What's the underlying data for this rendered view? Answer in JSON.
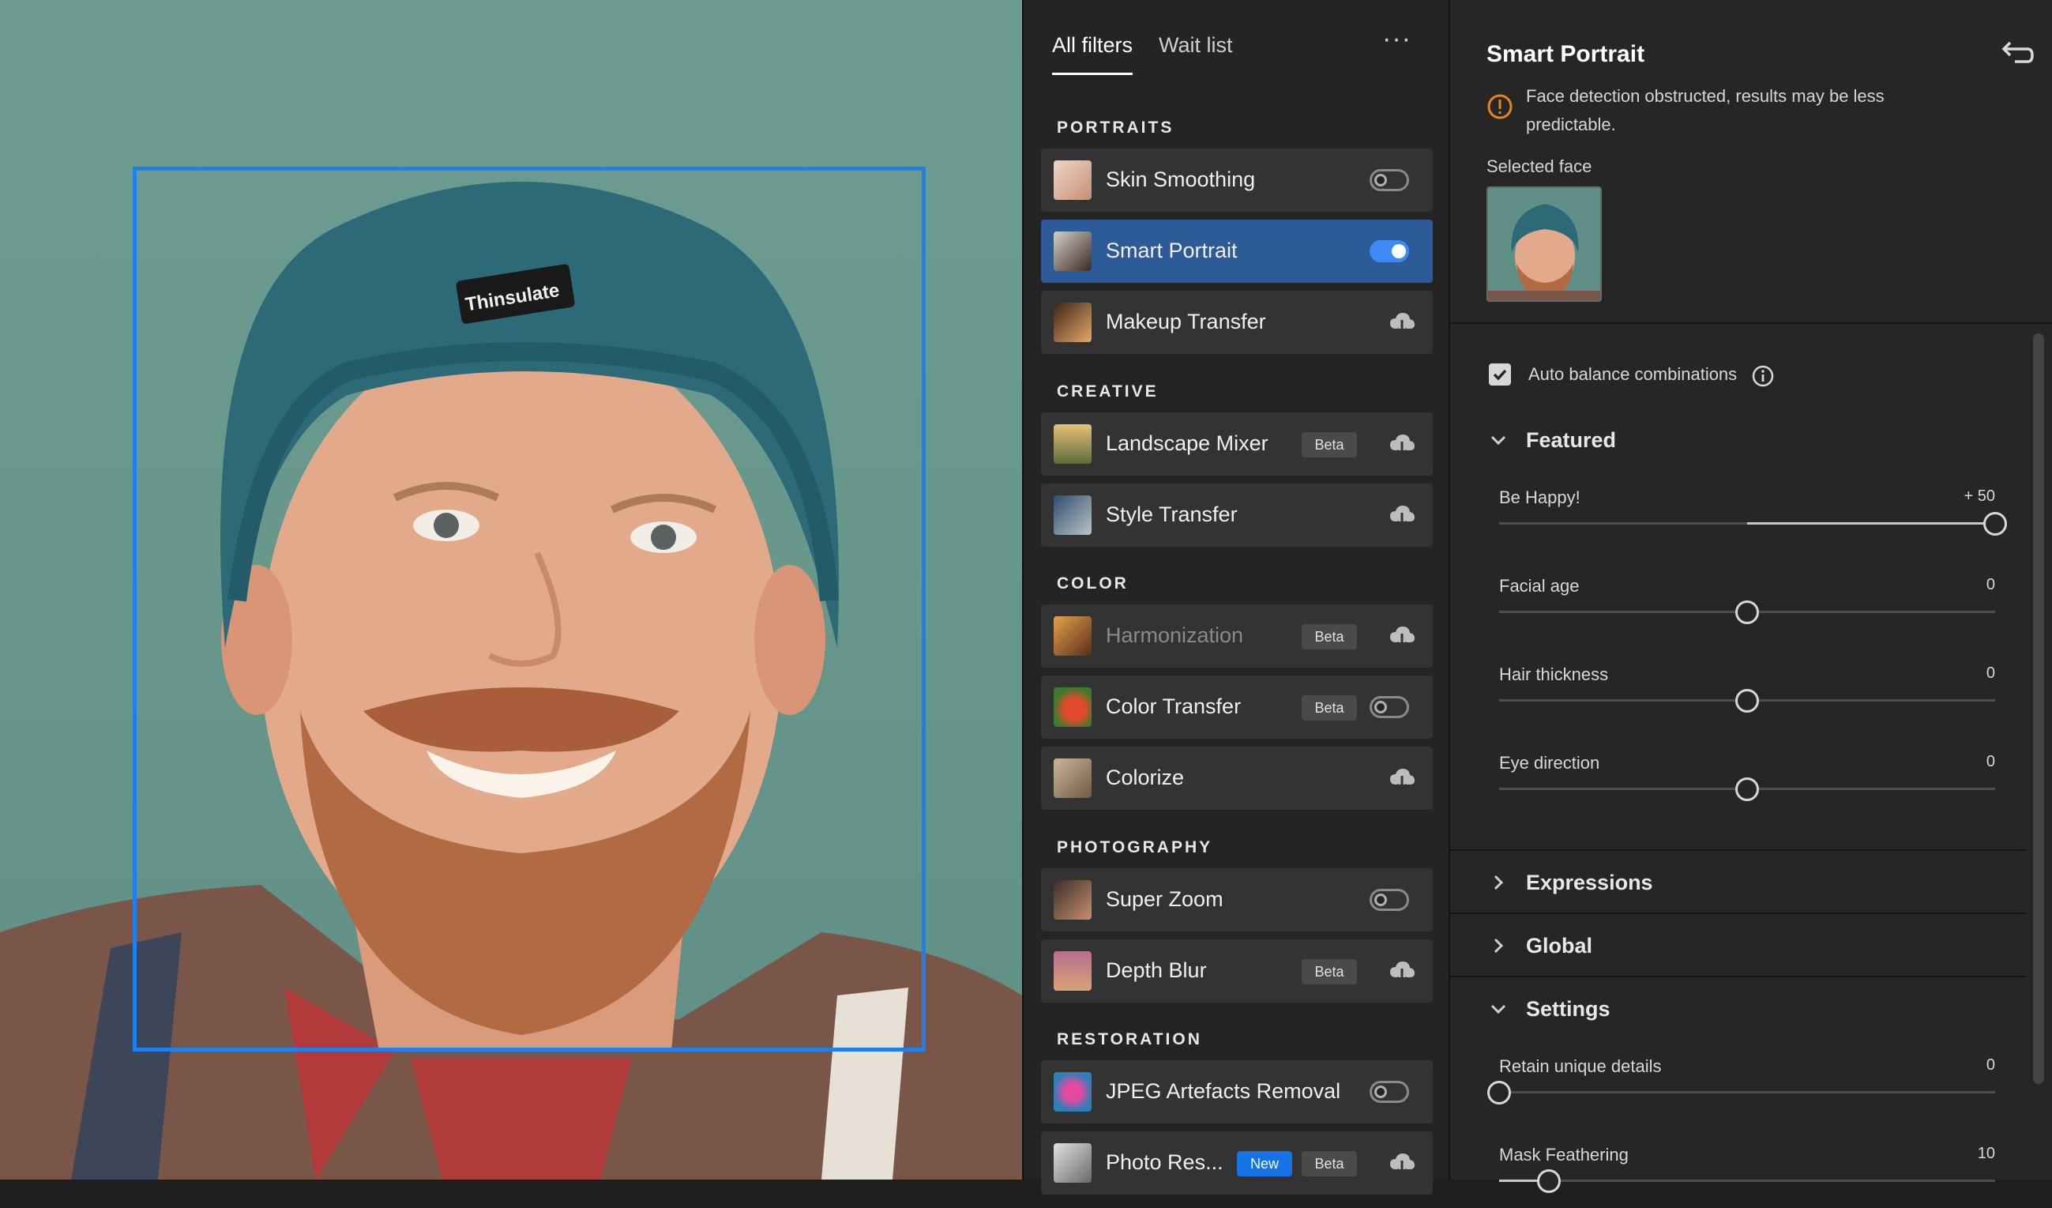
{
  "tabs": [
    {
      "label": "All filters",
      "active": true
    },
    {
      "label": "Wait list",
      "active": false
    }
  ],
  "more_label": "···",
  "sections": {
    "portraits": "PORTRAITS",
    "creative": "CREATIVE",
    "color": "COLOR",
    "photography": "PHOTOGRAPHY",
    "restoration": "RESTORATION"
  },
  "filters": {
    "skin_smoothing": {
      "label": "Skin Smoothing",
      "control": "toggle",
      "on": false
    },
    "smart_portrait": {
      "label": "Smart Portrait",
      "control": "toggle",
      "on": true
    },
    "makeup_transfer": {
      "label": "Makeup Transfer",
      "control": "cloud-download"
    },
    "landscape_mixer": {
      "label": "Landscape Mixer",
      "badge": "Beta",
      "control": "cloud-download"
    },
    "style_transfer": {
      "label": "Style Transfer",
      "control": "cloud-download"
    },
    "harmonization": {
      "label": "Harmonization",
      "badge": "Beta",
      "control": "cloud-download"
    },
    "color_transfer": {
      "label": "Color Transfer",
      "badge": "Beta",
      "control": "toggle",
      "on": false
    },
    "colorize": {
      "label": "Colorize",
      "control": "cloud-download"
    },
    "super_zoom": {
      "label": "Super Zoom",
      "control": "toggle",
      "on": false
    },
    "depth_blur": {
      "label": "Depth Blur",
      "badge": "Beta",
      "control": "cloud-download"
    },
    "jpeg_removal": {
      "label": "JPEG Artefacts Removal",
      "control": "toggle",
      "on": false
    },
    "photo_restoration": {
      "label": "Photo Res...",
      "badge_new": "New",
      "badge": "Beta",
      "control": "cloud-download"
    }
  },
  "panel": {
    "title": "Smart Portrait",
    "warning": "Face detection obstructed, results may be less predictable.",
    "selected_face_label": "Selected face",
    "auto_balance_label": "Auto balance combinations",
    "auto_balance_checked": true,
    "groups": {
      "featured": "Featured",
      "expressions": "Expressions",
      "global": "Global",
      "settings": "Settings"
    },
    "sliders": {
      "be_happy": {
        "label": "Be Happy!",
        "value_text": "+ 50",
        "value": 50,
        "min": -50,
        "max": 50
      },
      "facial_age": {
        "label": "Facial age",
        "value_text": "0",
        "value": 0,
        "min": -50,
        "max": 50
      },
      "hair_thickness": {
        "label": "Hair thickness",
        "value_text": "0",
        "value": 0,
        "min": -50,
        "max": 50
      },
      "eye_direction": {
        "label": "Eye direction",
        "value_text": "0",
        "value": 0,
        "min": -50,
        "max": 50
      },
      "retain_details": {
        "label": "Retain unique details",
        "value_text": "0",
        "value": 0,
        "min": 0,
        "max": 100
      },
      "mask_feathering": {
        "label": "Mask Feathering",
        "value_text": "10",
        "value": 10,
        "min": 0,
        "max": 100
      }
    }
  },
  "colors": {
    "accent": "#1473e6",
    "selection_bg": "#2c5b97",
    "face_box": "#1e7ff0",
    "warning": "#e68619"
  }
}
